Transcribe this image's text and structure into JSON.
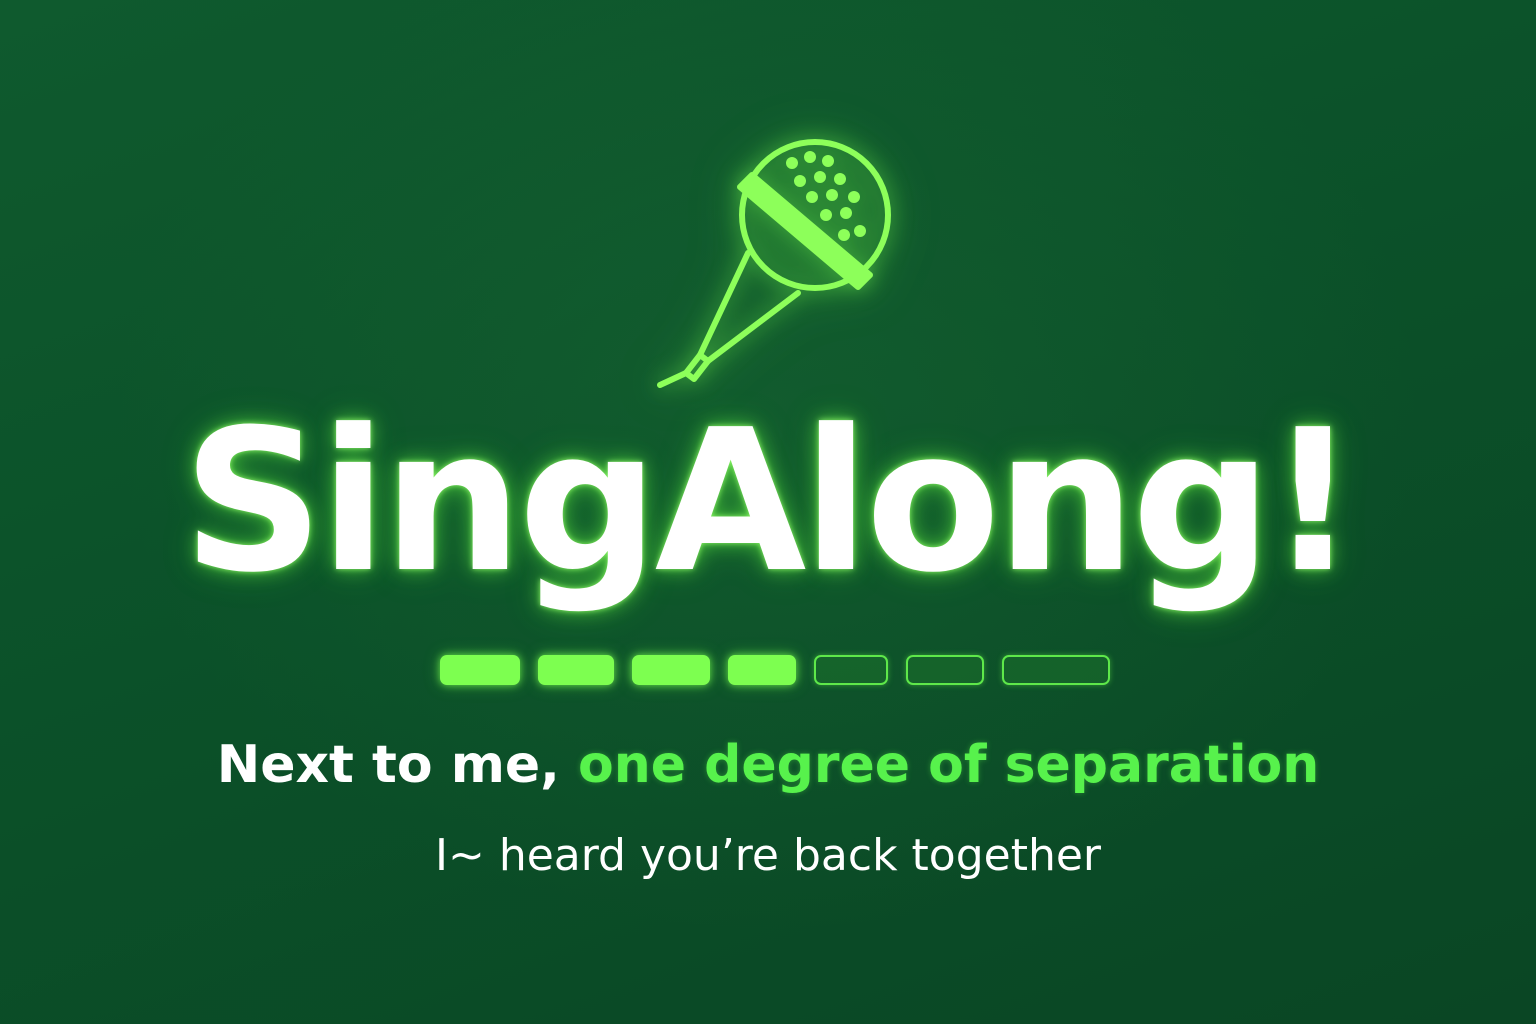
{
  "app": {
    "title": "SingAlong!",
    "icon": "microphone-icon",
    "accent_color": "#7dff50",
    "background_color": "#0b5129"
  },
  "progress": {
    "segments_total": 7,
    "segments_filled": 4,
    "fraction": 0.571
  },
  "lyrics": {
    "current_sung": "Next to me,",
    "current_upcoming": "one degree of separation",
    "next_line": "I~ heard you’re back together"
  }
}
